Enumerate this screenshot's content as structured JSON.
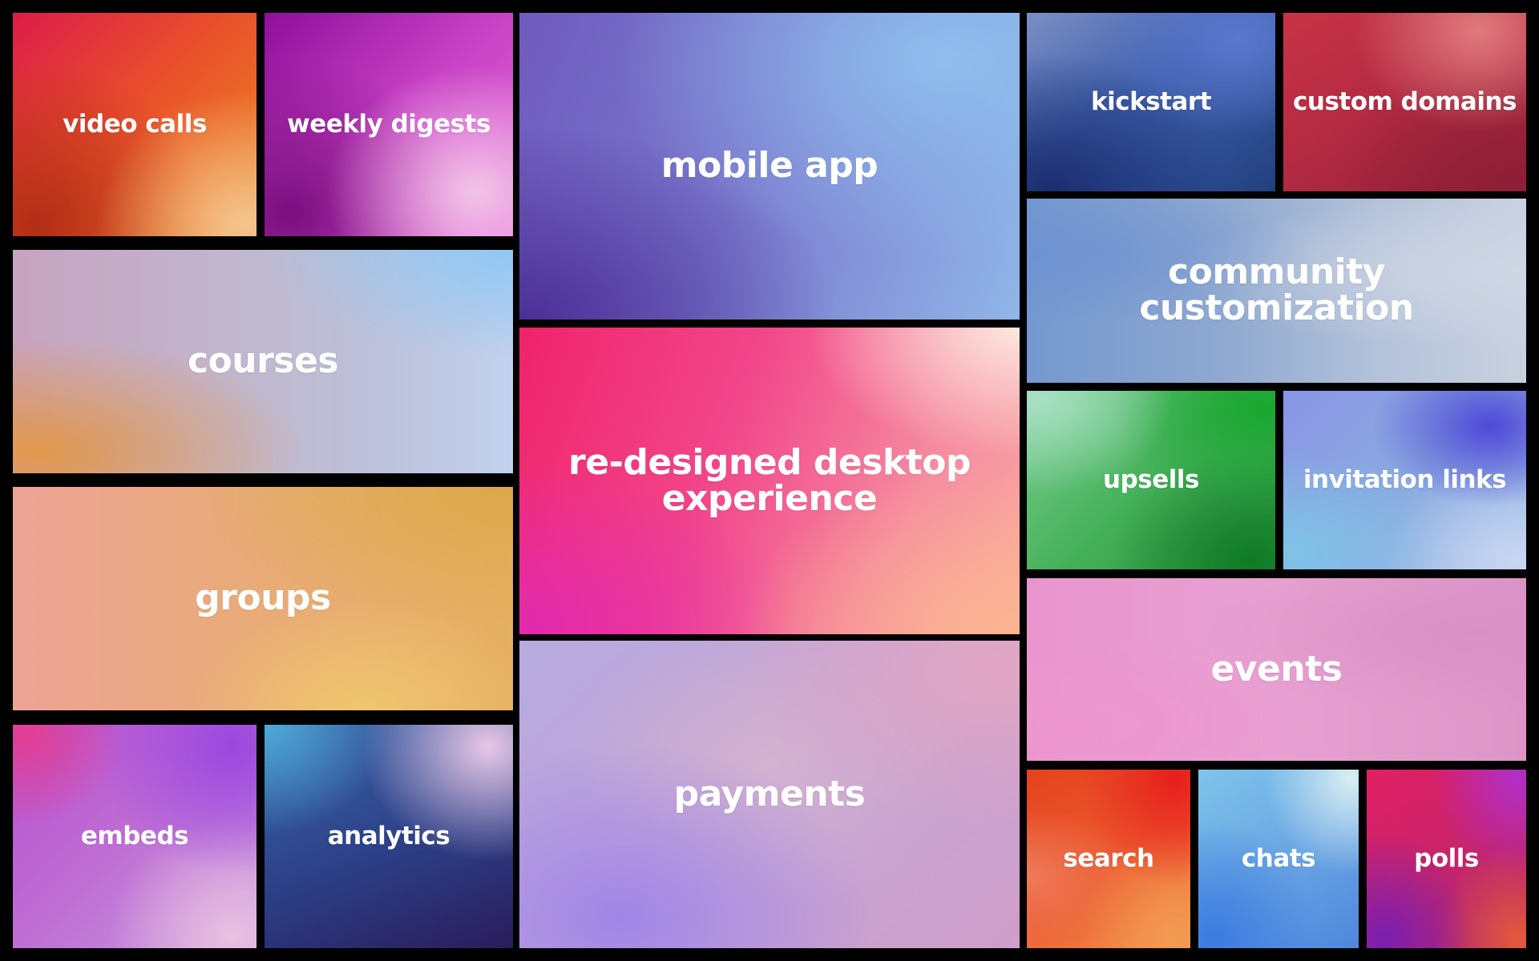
{
  "tiles": {
    "video_calls": "video calls",
    "weekly_digests": "weekly digests",
    "courses": "courses",
    "groups": "groups",
    "embeds": "embeds",
    "analytics": "analytics",
    "mobile_app": "mobile app",
    "redesigned_desktop": "re-designed desktop\nexperience",
    "payments": "payments",
    "kickstart": "kickstart",
    "custom_domains": "custom domains",
    "community_customization": "community\ncustomization",
    "upsells": "upsells",
    "invitation_links": "invitation links",
    "events": "events",
    "search": "search",
    "chats": "chats",
    "polls": "polls"
  },
  "colors": {
    "background": "#000000",
    "label": "#ffffff"
  }
}
